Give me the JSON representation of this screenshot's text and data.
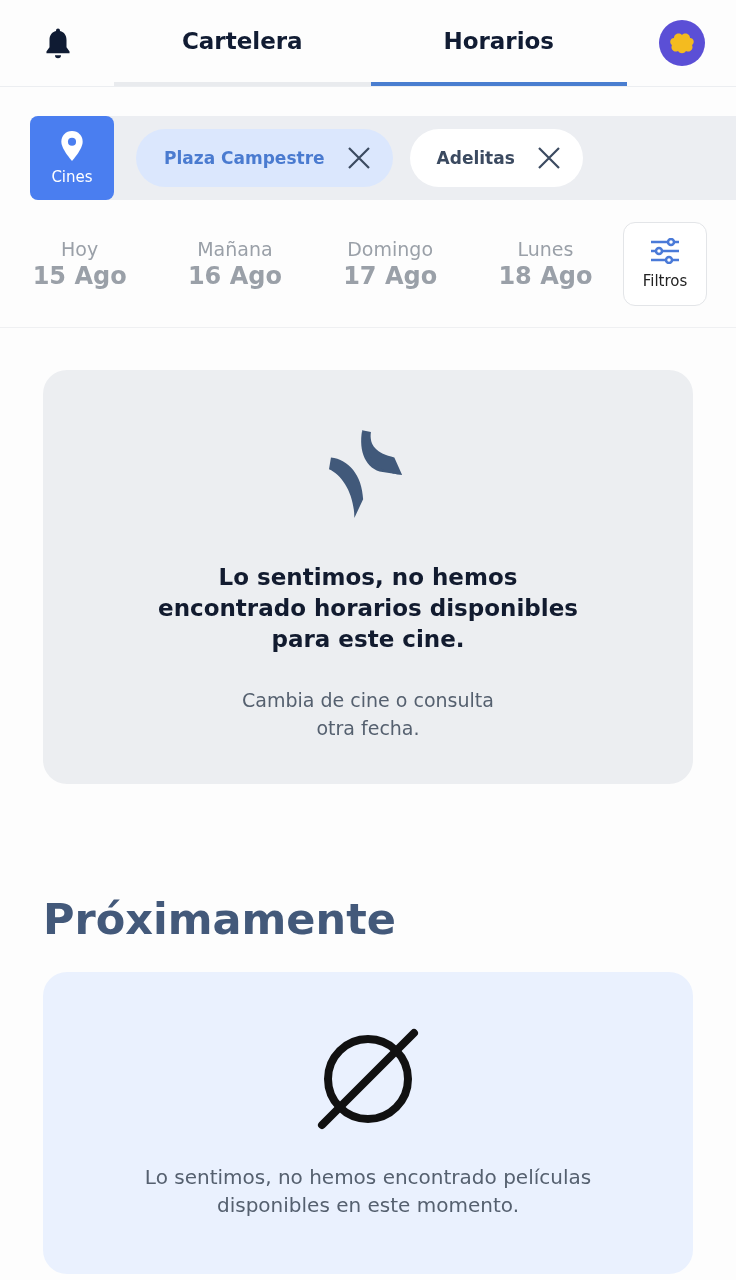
{
  "tabs": [
    {
      "label": "Cartelera",
      "selected": false
    },
    {
      "label": "Horarios",
      "selected": true
    }
  ],
  "location_button": {
    "label": "Cines"
  },
  "cinema_chips": [
    {
      "label": "Plaza Campestre",
      "selected": true
    },
    {
      "label": "Adelitas",
      "selected": false
    }
  ],
  "dates": [
    {
      "day": "Hoy",
      "date": "15 Ago",
      "selected": false
    },
    {
      "day": "Mañana",
      "date": "16 Ago",
      "selected": false
    },
    {
      "day": "Domingo",
      "date": "17 Ago",
      "selected": false
    },
    {
      "day": "Lunes",
      "date": "18 Ago",
      "selected": false
    }
  ],
  "filters_button": {
    "label": "Filtros"
  },
  "showtimes_empty": {
    "title": "Lo sentimos, no hemos encontrado horarios disponibles para este cine.",
    "message": "Cambia de cine o consulta otra fecha."
  },
  "upcoming": {
    "heading": "Próximamente",
    "message": "Lo sentimos, no hemos encontrado películas disponibles en este momento."
  }
}
